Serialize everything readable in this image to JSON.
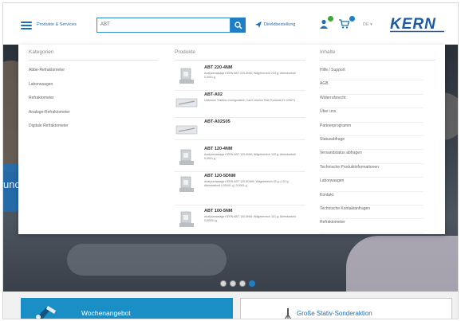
{
  "header": {
    "menu_label": "Produkte & Services",
    "search_value": "ABT",
    "direct_order_label": "Direktbestellung",
    "user_badge": "",
    "cart_badge": "",
    "language": "DE",
    "logo_text": "KERN"
  },
  "colors": {
    "brand_blue": "#1e7fc6",
    "badge_green": "#3aaa35"
  },
  "dropdown": {
    "categories_heading": "Kategorien",
    "products_heading": "Produkte",
    "contents_heading": "Inhalte",
    "categories": [
      "Abbe-Refraktometer",
      "Laborwaagen",
      "Refraktometer",
      "Analoge-Refraktometer",
      "Digitale Refraktometer"
    ],
    "products": [
      {
        "name": "ABT 220-4NM",
        "description": "Analysenwaage KERN ABT 220-4NM; Wägebereich 220 g; Ablesbarkeit 0,0001 g",
        "icon": "analytical-balance-icon"
      },
      {
        "name": "ABT-A02",
        "description": "Unknown Testbox-Configuration; Can't resolve Test Products ID 120874",
        "icon": "testbox-icon"
      },
      {
        "name": "ABT-A02S05",
        "description": "",
        "icon": "testbox-icon"
      },
      {
        "name": "ABT 120-4NM",
        "description": "Analysenwaage KERN ABT 120-4NM; Wägebereich 120 g; Ablesbarkeit 0,0001 g",
        "icon": "analytical-balance-icon"
      },
      {
        "name": "ABT 120-5DNM",
        "description": "Analysenwaage KERN ABT 120-5DNM; Wägebereich 42 g | 120 g; Ablesbarkeit 0,00001 g | 0,0001 g",
        "icon": "analytical-balance-icon"
      },
      {
        "name": "ABT 100-5NM",
        "description": "Analysenwaage KERN ABT 100-5NM; Wägebereich 101 g; Ablesbarkeit 0,00001 g",
        "icon": "analytical-balance-icon"
      }
    ],
    "contents": [
      "Hilfe / Support",
      "AGB",
      "Widerrufsrecht",
      "Über uns",
      "Partnerprogramm",
      "Statusabfrage",
      "Versandstatus abfragen",
      "Technische Produktinformationen",
      "Laborwaagen",
      "Kontakt",
      "Technische Kontaktanfragen",
      "Refraktometer"
    ]
  },
  "hero": {
    "partial_text": "unc",
    "slides": 4,
    "active_slide": 4
  },
  "bottom": {
    "offer_label": "Wochenangebot",
    "sale_label": "Große Stativ-Sonderaktion"
  }
}
